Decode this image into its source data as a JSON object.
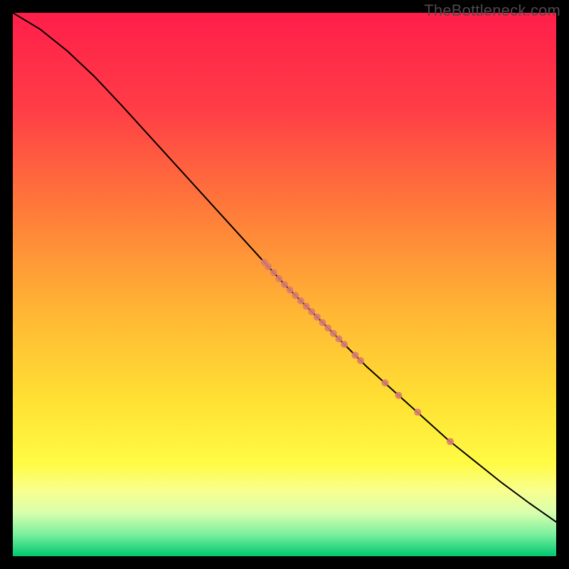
{
  "watermark": "TheBottleneck.com",
  "chart_data": {
    "type": "line",
    "title": "",
    "xlabel": "",
    "ylabel": "",
    "xlim": [
      0,
      100
    ],
    "ylim": [
      0,
      100
    ],
    "gradient_stops": [
      {
        "offset": 0.0,
        "color": "#ff1e4a"
      },
      {
        "offset": 0.18,
        "color": "#ff3e46"
      },
      {
        "offset": 0.36,
        "color": "#ff7a3a"
      },
      {
        "offset": 0.55,
        "color": "#ffb634"
      },
      {
        "offset": 0.72,
        "color": "#ffe233"
      },
      {
        "offset": 0.83,
        "color": "#fffb45"
      },
      {
        "offset": 0.88,
        "color": "#f8ff8f"
      },
      {
        "offset": 0.92,
        "color": "#d8ffad"
      },
      {
        "offset": 0.96,
        "color": "#7af09e"
      },
      {
        "offset": 1.0,
        "color": "#00c76f"
      }
    ],
    "series": [
      {
        "name": "curve",
        "type": "line",
        "stroke": "#000000",
        "stroke_width": 2,
        "x": [
          0,
          5,
          10,
          15,
          20,
          25,
          30,
          35,
          40,
          45,
          50,
          55,
          60,
          65,
          70,
          75,
          80,
          85,
          90,
          95,
          100
        ],
        "y": [
          100.0,
          97.0,
          93.0,
          88.3,
          83.0,
          77.5,
          72.0,
          66.5,
          61.0,
          55.5,
          50.0,
          45.0,
          40.0,
          35.0,
          30.5,
          26.0,
          21.5,
          17.5,
          13.5,
          9.8,
          6.3
        ]
      },
      {
        "name": "cluster",
        "type": "scatter",
        "color": "#d97b72",
        "radius": 5,
        "x": [
          46.3,
          47.0,
          48.0,
          49.0,
          50.0,
          51.0,
          52.0,
          53.0,
          54.0,
          55.0,
          56.0,
          57.0,
          58.0,
          59.0,
          60.0,
          61.0,
          63.0,
          64.0,
          68.5,
          71.0,
          74.5,
          80.5
        ],
        "y": [
          54.1,
          53.3,
          52.2,
          51.1,
          50.0,
          49.0,
          48.0,
          47.0,
          46.0,
          45.0,
          44.0,
          43.0,
          42.0,
          41.0,
          40.0,
          39.0,
          37.0,
          36.0,
          31.9,
          29.6,
          26.5,
          21.1
        ]
      }
    ],
    "frame": {
      "color": "#000000",
      "thickness_px": 18
    }
  }
}
